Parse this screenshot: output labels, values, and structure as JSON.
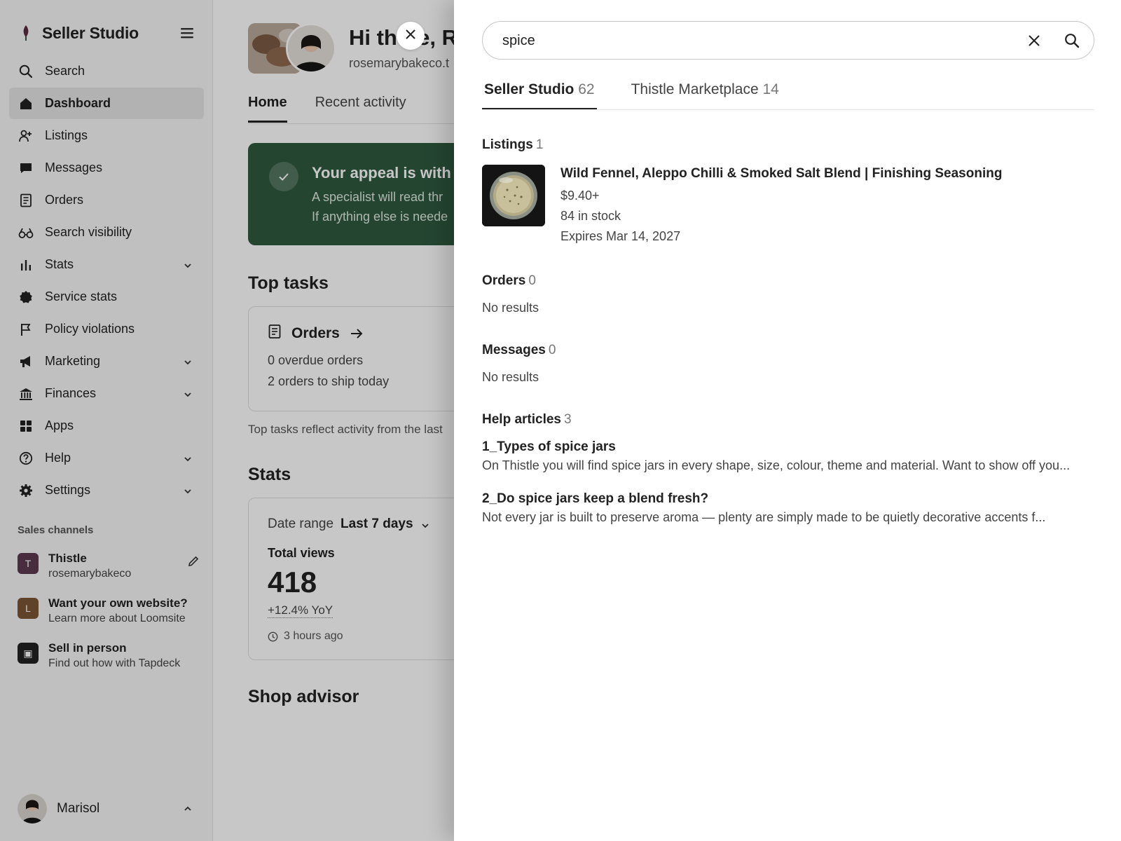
{
  "app": {
    "title": "Seller Studio"
  },
  "sidebar": {
    "items": [
      {
        "label": "Search",
        "icon": "search-icon"
      },
      {
        "label": "Dashboard",
        "icon": "home-icon",
        "active": true
      },
      {
        "label": "Listings",
        "icon": "listings-icon"
      },
      {
        "label": "Messages",
        "icon": "message-icon"
      },
      {
        "label": "Orders",
        "icon": "receipt-icon"
      },
      {
        "label": "Search visibility",
        "icon": "binoculars-icon"
      },
      {
        "label": "Stats",
        "icon": "bar-chart-icon",
        "expandable": true
      },
      {
        "label": "Service stats",
        "icon": "badge-icon"
      },
      {
        "label": "Policy violations",
        "icon": "flag-icon"
      },
      {
        "label": "Marketing",
        "icon": "megaphone-icon",
        "expandable": true
      },
      {
        "label": "Finances",
        "icon": "bank-icon",
        "expandable": true
      },
      {
        "label": "Apps",
        "icon": "grid-icon"
      },
      {
        "label": "Help",
        "icon": "help-icon",
        "expandable": true
      },
      {
        "label": "Settings",
        "icon": "gear-icon",
        "expandable": true
      }
    ],
    "channels_title": "Sales channels",
    "channels": [
      {
        "badge": "T",
        "name": "Thistle",
        "sub": "rosemarybakeco",
        "color": "#5b3a4f"
      },
      {
        "badge": "L",
        "name": "Want your own website?",
        "sub": "Learn more about Loomsite",
        "color": "#7a5532"
      },
      {
        "badge": "▣",
        "name": "Sell in person",
        "sub": "Find out how with Tapdeck",
        "color": "#222222"
      }
    ],
    "user": {
      "name": "Marisol"
    }
  },
  "main": {
    "greeting": "Hi there, Ros",
    "shop_url": "rosemarybakeco.t",
    "tabs": [
      {
        "label": "Home",
        "active": true
      },
      {
        "label": "Recent activity"
      }
    ],
    "appeal": {
      "title": "Your appeal is with a",
      "line1": "A specialist will read thr",
      "line2": "If anything else is neede",
      "color": "#2f5a3f"
    },
    "top_tasks_title": "Top tasks",
    "orders_task": {
      "title": "Orders",
      "line1": "0 overdue orders",
      "line2": "2 orders to ship today"
    },
    "footnote": "Top tasks reflect activity from the last",
    "stats_title": "Stats",
    "stats": {
      "range_label": "Date range",
      "range_value": "Last 7 days",
      "metric_label": "Total views",
      "metric_value": "418",
      "change": "+12.4% YoY",
      "updated": "3 hours ago"
    },
    "advisor_title": "Shop advisor"
  },
  "search": {
    "query": "spice",
    "tabs": [
      {
        "label": "Seller Studio",
        "count": "62",
        "active": true
      },
      {
        "label": "Thistle Marketplace",
        "count": "14"
      }
    ],
    "listings": {
      "title": "Listings",
      "count": "1",
      "items": [
        {
          "title": "Wild Fennel, Aleppo Chilli & Smoked Salt Blend | Finishing Seasoning",
          "price": "$9.40+",
          "stock": "84 in stock",
          "expires": "Expires Mar 14, 2027"
        }
      ]
    },
    "orders": {
      "title": "Orders",
      "count": "0",
      "empty": "No results"
    },
    "messages": {
      "title": "Messages",
      "count": "0",
      "empty": "No results"
    },
    "help": {
      "title": "Help articles",
      "count": "3",
      "items": [
        {
          "title": "1_Types of spice jars",
          "desc": "On Thistle you will find spice jars in every shape, size, colour, theme and material. Want to show off you..."
        },
        {
          "title": "2_Do spice jars keep a blend fresh?",
          "desc": "Not every jar is built to preserve aroma — plenty are simply made to be quietly decorative accents f..."
        }
      ]
    }
  }
}
